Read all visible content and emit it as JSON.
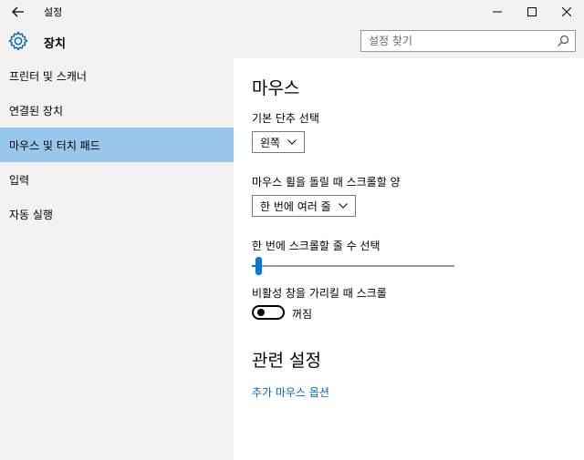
{
  "window": {
    "title": "설정",
    "back_icon": "back-arrow-icon",
    "controls": [
      "minimize-icon",
      "maximize-icon",
      "close-icon"
    ]
  },
  "header": {
    "title": "장치",
    "icon": "gear-icon",
    "search": {
      "placeholder": "설정 찾기",
      "value": ""
    }
  },
  "sidebar": {
    "items": [
      {
        "label": "프린터 및 스캐너",
        "selected": false
      },
      {
        "label": "연결된 장치",
        "selected": false
      },
      {
        "label": "마우스 및 터치 패드",
        "selected": true
      },
      {
        "label": "입력",
        "selected": false
      },
      {
        "label": "자동 실행",
        "selected": false
      }
    ]
  },
  "main": {
    "section_title": "마우스",
    "primary_button": {
      "label": "기본 단추 선택",
      "value": "왼쪽"
    },
    "wheel_scroll": {
      "label": "마우스 휠을 돌릴 때 스크롤할 양",
      "value": "한 번에 여러 줄"
    },
    "lines_slider": {
      "label": "한 번에 스크롤할 줄 수 선택",
      "level": 0.02
    },
    "inactive_scroll": {
      "label": "비활성 창을 가리킬 때 스크롤",
      "state": "꺼짐"
    },
    "related_title": "관련 설정",
    "related_link": "추가 마우스 옵션"
  },
  "colors": {
    "accent": "#0078d7",
    "selected_bg": "#99c7ec",
    "chrome_bg": "#f2f2f2",
    "link": "#0067c0"
  }
}
